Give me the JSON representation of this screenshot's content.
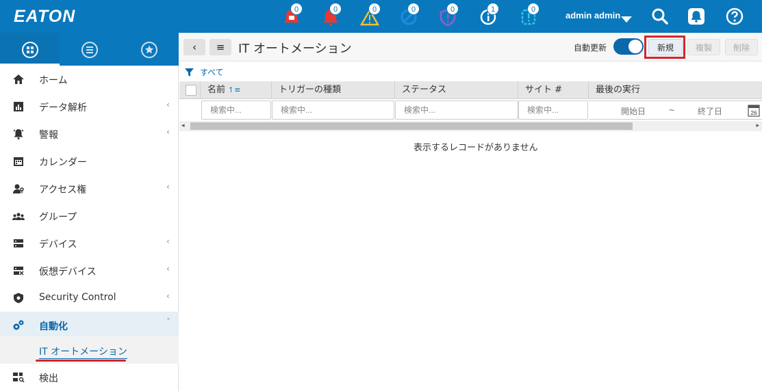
{
  "brand": {
    "logo_text": "E·T·N",
    "name": "EATON"
  },
  "header": {
    "notification_counts": [
      "0",
      "0",
      "0",
      "0",
      "0",
      "1",
      "0"
    ],
    "notification_icons": [
      "alarm-locked-icon",
      "alarm-icon",
      "warning-icon",
      "disabled-icon",
      "shield-alert-icon",
      "info-icon",
      "event-icon"
    ],
    "user_name": "admin admin",
    "colors": {
      "brand_blue": "#0a78bd",
      "alarm_red": "#e8392f",
      "warning_yellow": "#f2c12e",
      "disabled_blue": "#1b8ede",
      "shield_purple": "#8b5fc8",
      "event_cyan": "#2ec6e8"
    }
  },
  "sidebar_tabs": [
    "grid-icon",
    "list-icon",
    "star-icon"
  ],
  "sidebar": {
    "items": [
      {
        "label": "ホーム",
        "icon": "home-icon",
        "has_children": false
      },
      {
        "label": "データ解析",
        "icon": "chart-icon",
        "has_children": true
      },
      {
        "label": "警報",
        "icon": "alarm-icon",
        "has_children": true
      },
      {
        "label": "カレンダー",
        "icon": "calendar-icon",
        "has_children": false
      },
      {
        "label": "アクセス権",
        "icon": "user-key-icon",
        "has_children": true
      },
      {
        "label": "グループ",
        "icon": "group-icon",
        "has_children": false
      },
      {
        "label": "デバイス",
        "icon": "server-icon",
        "has_children": true
      },
      {
        "label": "仮想デバイス",
        "icon": "virtual-device-icon",
        "has_children": true
      },
      {
        "label": "Security Control",
        "icon": "shield-icon",
        "has_children": true
      },
      {
        "label": "自動化",
        "icon": "gears-icon",
        "has_children": true,
        "expanded": true
      },
      {
        "label": "検出",
        "icon": "discover-icon",
        "has_children": false
      }
    ],
    "sub_item": "IT オートメーション"
  },
  "toolbar": {
    "back_label": "‹",
    "menu_label": "≡",
    "title": "IT オートメーション",
    "auto_refresh_label": "自動更新",
    "auto_refresh_on": true,
    "new_label": "新規",
    "copy_label": "複製",
    "delete_label": "削除"
  },
  "filter": {
    "label": "すべて"
  },
  "table": {
    "columns": [
      "名前",
      "トリガーの種類",
      "ステータス",
      "サイト #",
      "最後の実行"
    ],
    "search_placeholder": "検索中...",
    "date_start": "開始日",
    "date_sep": "~",
    "date_end": "終了日",
    "calendar_day": "26",
    "empty_message": "表示するレコードがありません"
  }
}
